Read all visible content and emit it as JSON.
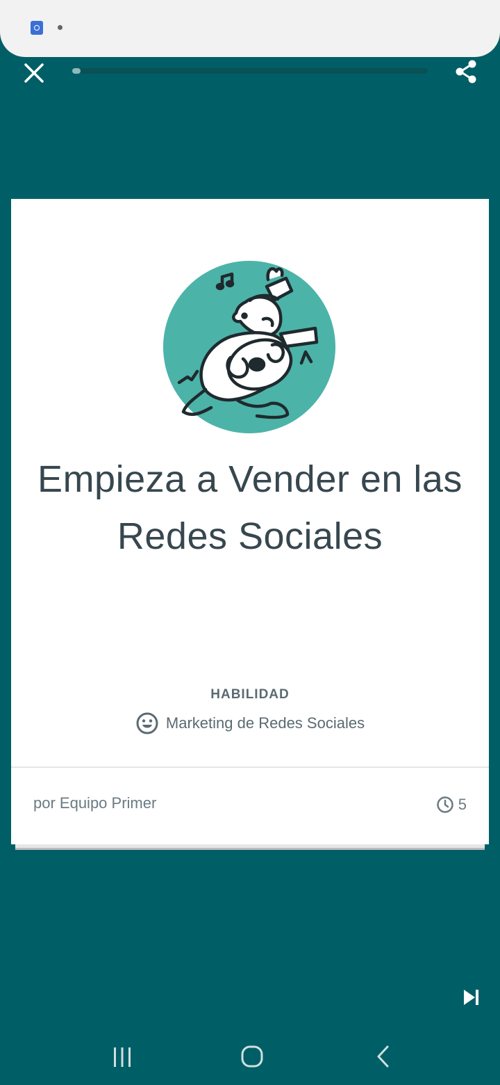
{
  "lesson": {
    "progress_fraction": 0.02,
    "title": "Empieza a Vender en las Redes Sociales",
    "skill_label": "HABILIDAD",
    "skill_name": "Marketing de Redes Sociales",
    "author": "por Equipo Primer",
    "duration": "5"
  },
  "icons": {
    "close": "close-icon",
    "share": "share-icon",
    "skill": "smiley-face-icon",
    "clock": "clock-icon",
    "skip": "skip-next-icon",
    "nav_recents": "recents-icon",
    "nav_home": "home-icon",
    "nav_back": "back-icon"
  },
  "colors": {
    "background": "#005f66",
    "card": "#ffffff",
    "illustration_circle": "#4cb3a9",
    "text_dark": "#37474f",
    "text_muted": "#6b7a82"
  }
}
